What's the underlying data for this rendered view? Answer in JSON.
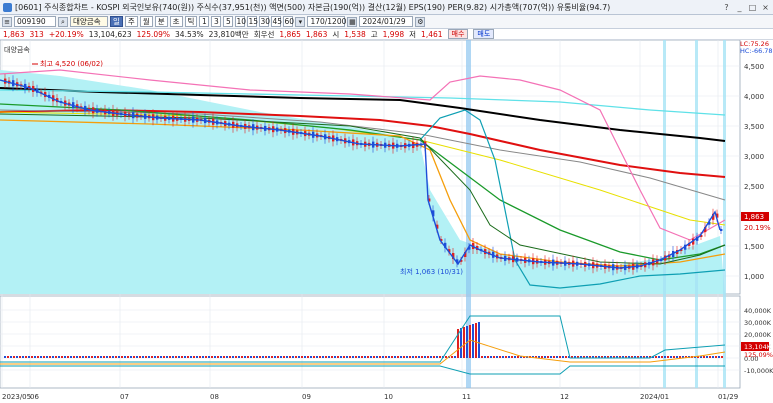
{
  "window": {
    "title": "[0601] 주식종합차트 - KOSPI 외국인보유(740(원)) 주식수(37,951(천)) 액면(500) 자본금(190(억)) 결산(12월) EPS(190) PER(9.82) 시가총액(707(억)) 유통비율(94.7)",
    "buttons": [
      "?",
      "_",
      "□",
      "×"
    ]
  },
  "toolbar": {
    "code": "009190",
    "name": "대양금속",
    "periods": [
      "주",
      "월",
      "분",
      "초",
      "틱"
    ],
    "selected_period": "일",
    "minutes": [
      "1",
      "3",
      "5",
      "10",
      "15",
      "30",
      "45",
      "60"
    ],
    "range": "170/1200",
    "date": "2024/01/29"
  },
  "quote": {
    "price": "1,863",
    "change": "313",
    "change_pct": "+20.19%",
    "volume": "13,104,623",
    "volume_pct": "125.09%",
    "amount": "34.53%",
    "trade_value": "23,810백만",
    "cap_label": "회우선",
    "v1": "1,865",
    "v2": "1,863",
    "open_label": "시",
    "open": "1,538",
    "high_label": "고",
    "high": "1,998",
    "low_label": "저",
    "low": "1,461",
    "buy_label": "매수",
    "sell_label": "매도"
  },
  "chart": {
    "stock_label": "대양금속",
    "high_annotation": "최고 4,520 (06/02)",
    "low_annotation": "최저 1,063 (10/31)",
    "right_labels": {
      "lc": "LC:75.26",
      "hc": "HC:-66.78"
    },
    "price_axis": [
      "4,500",
      "4,000",
      "3,500",
      "3,000",
      "2,500",
      "2,000",
      "1,500",
      "1,000"
    ],
    "price_tag": "1,863",
    "pct_tag": "20.19%",
    "volume_axis": [
      "40,000K",
      "30,000K",
      "20,000K",
      "10,000K",
      "0.00",
      "-10,000K"
    ],
    "volume_tag": "13,104K",
    "volume_pct_tag": "125.09%",
    "x_labels": [
      "2023/05",
      "06",
      "07",
      "08",
      "09",
      "10",
      "11",
      "12",
      "2024/01",
      "01/29"
    ],
    "colors": {
      "up": "#e02020",
      "down": "#1d4ed8",
      "fill": "#b3f1f5",
      "highlight": "#8ec6f0"
    }
  }
}
